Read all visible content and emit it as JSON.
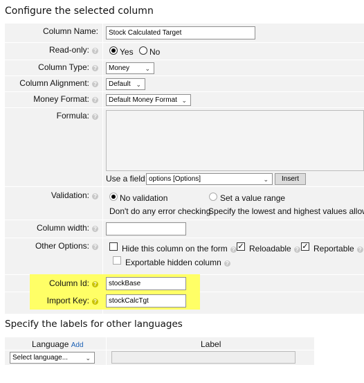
{
  "sections": {
    "configure_title": "Configure the selected column",
    "languages_title": "Specify the labels for other languages"
  },
  "fields": {
    "column_name": {
      "label": "Column Name:",
      "value": "Stock Calculated Target"
    },
    "read_only": {
      "label": "Read-only:",
      "yes": "Yes",
      "no": "No",
      "selected": "Yes"
    },
    "column_type": {
      "label": "Column Type:",
      "value": "Money"
    },
    "column_alignment": {
      "label": "Column Alignment:",
      "value": "Default"
    },
    "money_format": {
      "label": "Money Format:",
      "value": "Default Money Format"
    },
    "formula": {
      "label": "Formula:",
      "use_field_label": "Use a field:",
      "field_value": "options [Options]",
      "insert_label": "Insert"
    },
    "validation": {
      "label": "Validation:",
      "no_validation": "No validation",
      "no_validation_desc": "Don't do any error checking",
      "value_range": "Set a value range",
      "value_range_desc": "Specify the lowest and highest values allowed"
    },
    "column_width": {
      "label": "Column width:",
      "value": ""
    },
    "other_options": {
      "label": "Other Options:",
      "hide": "Hide this column on the form",
      "reloadable": "Reloadable",
      "reportable": "Reportable",
      "exportable_hidden": "Exportable hidden column"
    },
    "column_id": {
      "label": "Column Id:",
      "value": "stockBase"
    },
    "import_key": {
      "label": "Import Key:",
      "value": "stockCalcTgt"
    }
  },
  "languages": {
    "language_header": "Language",
    "add_link": "Add",
    "label_header": "Label",
    "select_placeholder": "Select language..."
  },
  "icons": {
    "help": "question-icon",
    "help_symbol": "?"
  },
  "colors": {
    "highlight": "#ffff66",
    "row_bg": "#f2f2f2",
    "link": "#1a5fb4"
  }
}
